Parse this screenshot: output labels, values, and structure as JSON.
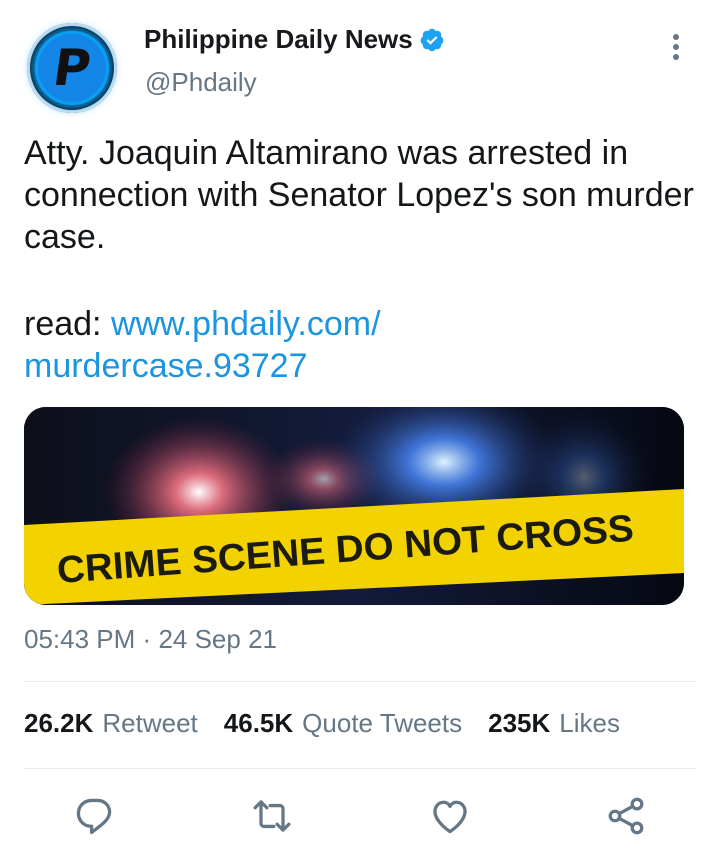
{
  "account": {
    "name": "Philippine Daily News",
    "handle": "@Phdaily",
    "avatar_letter": "P"
  },
  "tweet": {
    "text": "Atty. Joaquin Altamirano was arrested in connection with Senator Lopez's son murder case.",
    "read_prefix": "read:",
    "link_line1": "www.phdaily.com/",
    "link_line2": "murdercase.93727",
    "media_caption": "CRIME SCENE DO NOT CROSS",
    "time": "05:43 PM",
    "separator": "·",
    "date": "24 Sep 21"
  },
  "stats": {
    "retweets_count": "26.2K",
    "retweets_label": "Retweet",
    "quotes_count": "46.5K",
    "quotes_label": "Quote Tweets",
    "likes_count": "235K",
    "likes_label": "Likes"
  },
  "icons": {
    "verified": "verified-badge-icon",
    "more": "more-vertical-icon",
    "reply": "reply-icon",
    "retweet": "retweet-icon",
    "like": "heart-icon",
    "share": "share-icon"
  },
  "colors": {
    "accent": "#1b95e0",
    "secondary_text": "#657786",
    "tape_yellow": "#f2d200"
  }
}
